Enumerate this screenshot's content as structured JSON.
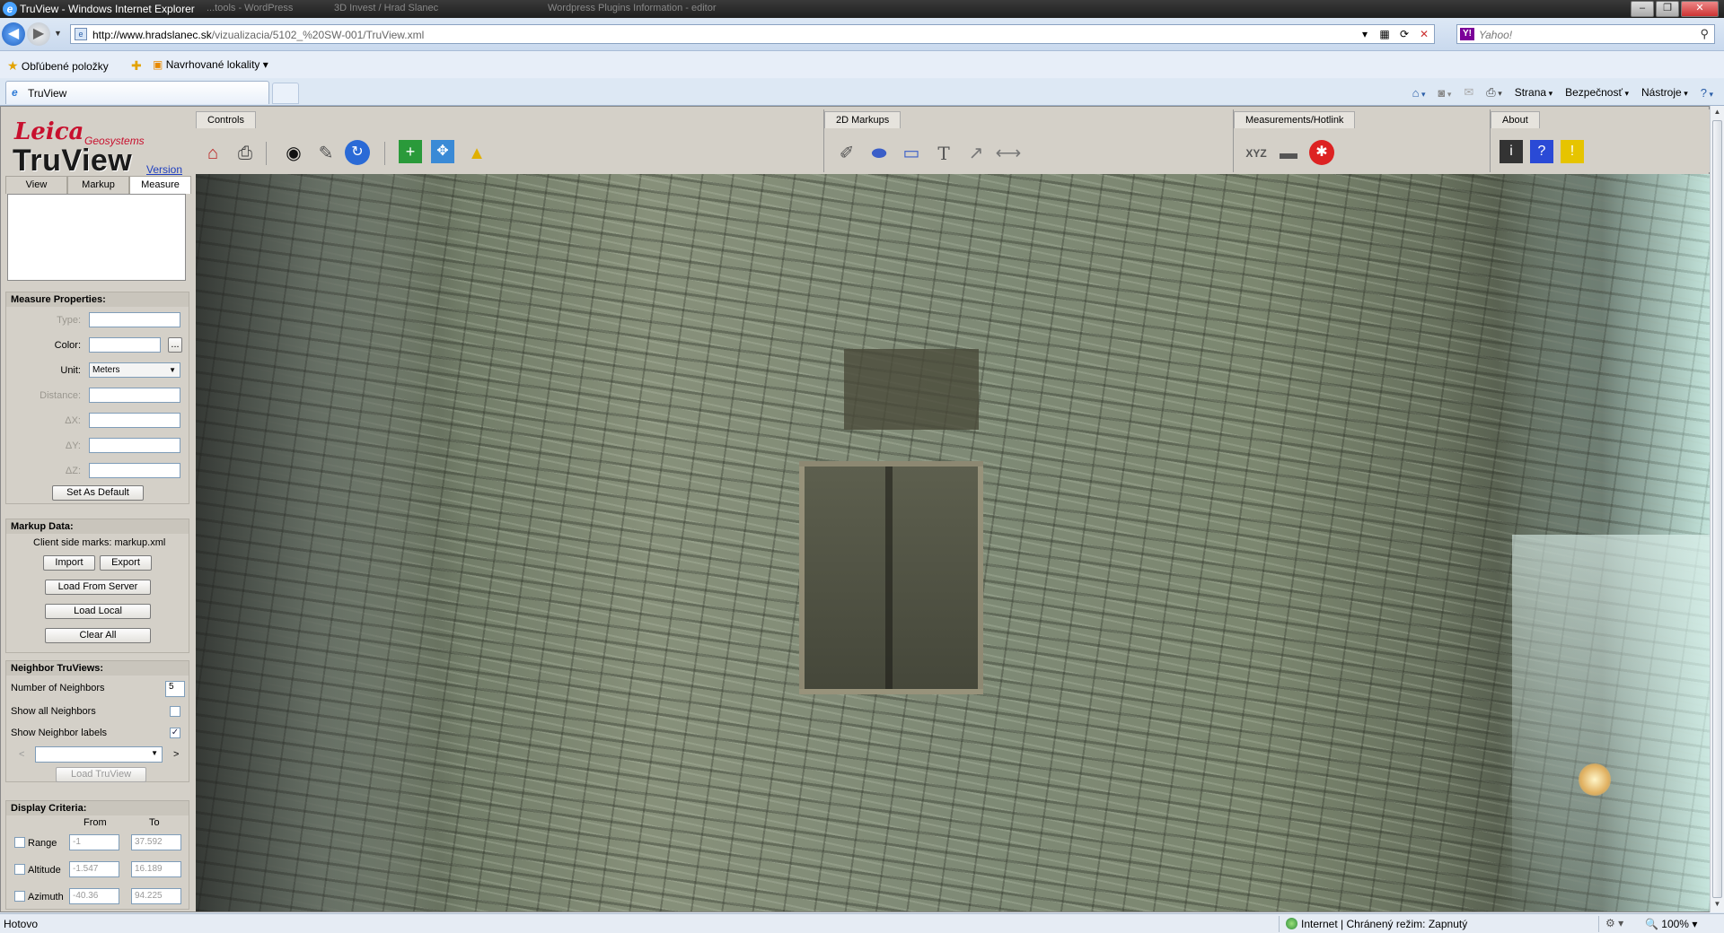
{
  "browser": {
    "window_title": "TruView - Windows Internet Explorer",
    "ghost_tab_1": "...tools - WordPress",
    "ghost_tab_2": "3D Invest / Hrad Slanec",
    "ghost_tab_3": "Wordpress Plugins Information - editor",
    "url_domain": "http://www.hradslanec.sk",
    "url_path": "/vizualizacia/5102_%20SW-001/TruView.xml",
    "search_placeholder": "Yahoo!",
    "favorites_label": "Obľúbené položky",
    "suggested_sites_label": "Navrhované lokality",
    "tab_title": "TruView",
    "cmd": {
      "page": "Strana",
      "safety": "Bezpečnosť",
      "tools": "Nástroje"
    }
  },
  "app": {
    "logo": {
      "brand": "Leica",
      "sub": "Geosystems",
      "product": "TruView",
      "version_link": "Version"
    },
    "left_tabs": [
      "View",
      "Markup",
      "Measure"
    ],
    "active_left_tab": "Measure",
    "measure_properties": {
      "header": "Measure Properties:",
      "type_label": "Type:",
      "color_label": "Color:",
      "color_button": "...",
      "unit_label": "Unit:",
      "unit_value": "Meters",
      "distance_label": "Distance:",
      "dx_label": "ΔX:",
      "dy_label": "ΔY:",
      "dz_label": "ΔZ:",
      "set_default": "Set As Default"
    },
    "markup_data": {
      "header": "Markup Data:",
      "client_marks": "Client side marks: markup.xml",
      "import": "Import",
      "export": "Export",
      "load_server": "Load From Server",
      "load_local": "Load Local",
      "clear_all": "Clear All"
    },
    "neighbor": {
      "header": "Neighbor TruViews:",
      "number_label": "Number of Neighbors",
      "number_value": "5",
      "show_all_label": "Show all Neighbors",
      "show_labels_label": "Show Neighbor labels",
      "show_labels_checked": "✓",
      "prev": "<",
      "next": ">",
      "load_truview": "Load TruView"
    },
    "display_criteria": {
      "header": "Display Criteria:",
      "from": "From",
      "to": "To",
      "rows": [
        {
          "label": "Range",
          "from": "-1",
          "to": "37.592"
        },
        {
          "label": "Altitude",
          "from": "-1.547",
          "to": "16.189"
        },
        {
          "label": "Azimuth",
          "from": "-40.36",
          "to": "94.225"
        }
      ]
    },
    "toolbar": {
      "controls": "Controls",
      "markups": "2D Markups",
      "measurements": "Measurements/Hotlink",
      "about": "About",
      "xyz": "XYZ"
    }
  },
  "status": {
    "left": "Hotovo",
    "zone": "Internet | Chránený režim: Zapnutý",
    "zoom": "100%"
  },
  "colors": {
    "leica_red": "#c8102e",
    "ie_blue": "#2e7ad6",
    "panel_gray": "#d4d0c8"
  }
}
